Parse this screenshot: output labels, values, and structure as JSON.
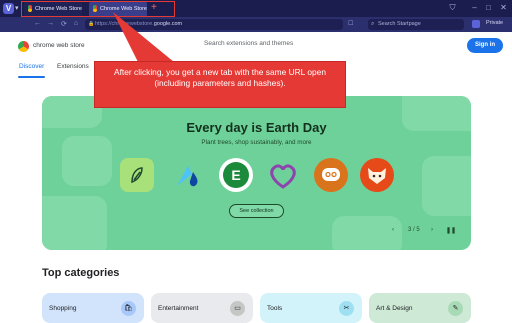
{
  "browser": {
    "menu_glyph": "▾",
    "tabs": [
      {
        "title": "Chrome Web Store"
      },
      {
        "title": "Chrome Web Store"
      }
    ],
    "new_tab_glyph": "+",
    "nav": {
      "back": "←",
      "forward": "→",
      "reload": "⟳",
      "home": "⌂"
    },
    "url_prefix": "https://chromewebstore.",
    "url_domain": "google.com",
    "search_placeholder": "Search Startpage",
    "private_label": "Private"
  },
  "callout": {
    "text": "After clicking, you get a new tab with the same URL open (including parameters and hashes)."
  },
  "store": {
    "name": "chrome web store",
    "search_placeholder": "Search extensions and themes",
    "sign_in": "Sign in",
    "tabs": [
      "Discover",
      "Extensions"
    ]
  },
  "banner": {
    "title": "Every day is Earth Day",
    "subtitle": "Plant trees, shop sustainably, and more",
    "cta": "See collection",
    "page_indicator": "3 / 5",
    "apps": [
      {
        "icon": "leaf-app-icon",
        "color": "#a8e07a"
      },
      {
        "icon": "water-drop-app-icon",
        "color": "#6fd19a"
      },
      {
        "icon": "tree-e-app-icon",
        "color": "#ffffff"
      },
      {
        "icon": "purple-heart-app-icon",
        "color": "#6fd19a"
      },
      {
        "icon": "speech-bubble-app-icon",
        "color": "#d9731c"
      },
      {
        "icon": "fox-app-icon",
        "color": "#e64a19"
      }
    ]
  },
  "categories": {
    "heading": "Top categories",
    "items": [
      {
        "label": "Shopping",
        "color": "#d2e3fc",
        "icon_color": "#a8c7fa"
      },
      {
        "label": "Entertainment",
        "color": "#e8eaed",
        "icon_color": "#c4c7c5"
      },
      {
        "label": "Tools",
        "color": "#d3f3fb",
        "icon_color": "#9fdff2"
      },
      {
        "label": "Art & Design",
        "color": "#ceead6",
        "icon_color": "#a8dab5"
      }
    ]
  }
}
